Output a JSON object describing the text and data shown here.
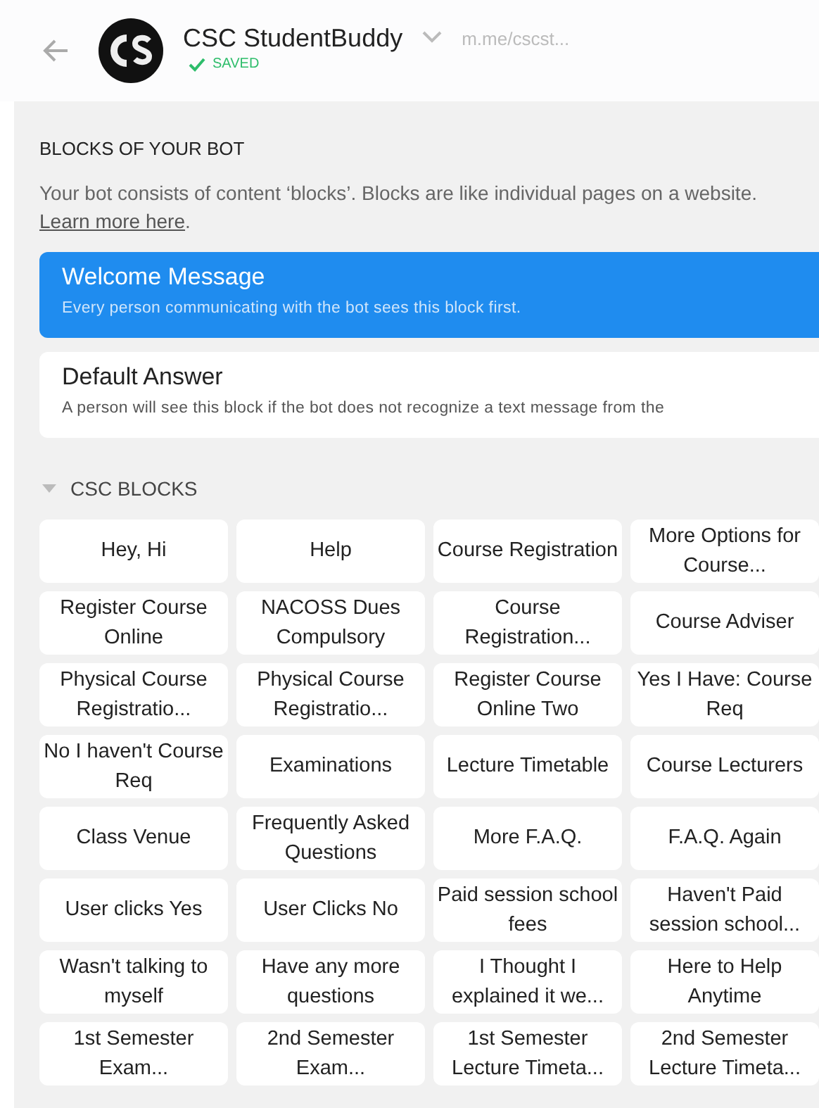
{
  "header": {
    "title": "CSC StudentBuddy",
    "status": "SAVED",
    "link": "m.me/cscst..."
  },
  "section": {
    "heading": "BLOCKS OF YOUR BOT",
    "description": "Your bot consists of content ‘blocks’. Blocks are like individual pages on a website. ",
    "link": "Learn more here",
    "after_link": "."
  },
  "main_blocks": [
    {
      "title": "Welcome Message",
      "subtitle": "Every person communicating with the bot sees this block first.",
      "selected": true
    },
    {
      "title": "Default Answer",
      "subtitle": "A person will see this block if the bot does not recognize a text message from the",
      "selected": false
    }
  ],
  "group": {
    "name": "CSC BLOCKS",
    "expanded": true,
    "blocks": [
      "Hey, Hi",
      "Help",
      "Course Registration",
      "More Options for Course...",
      "Register Course Online",
      "NACOSS Dues Compulsory",
      "Course Registration...",
      "Course Adviser",
      "Physical Course Registratio...",
      "Physical Course Registratio...",
      "Register Course Online Two",
      "Yes I Have: Course Req",
      "No I haven't Course Req",
      "Examinations",
      "Lecture Timetable",
      "Course Lecturers",
      "Class Venue",
      "Frequently Asked Questions",
      "More F.A.Q.",
      "F.A.Q. Again",
      "User clicks Yes",
      "User Clicks No",
      "Paid session school fees",
      "Haven't Paid session school...",
      "Wasn't talking to myself",
      "Have any more questions",
      "I Thought I explained it we...",
      "Here to Help Anytime",
      "1st Semester Exam...",
      "2nd Semester Exam...",
      "1st Semester Lecture Timeta...",
      "2nd Semester Lecture Timeta..."
    ]
  }
}
